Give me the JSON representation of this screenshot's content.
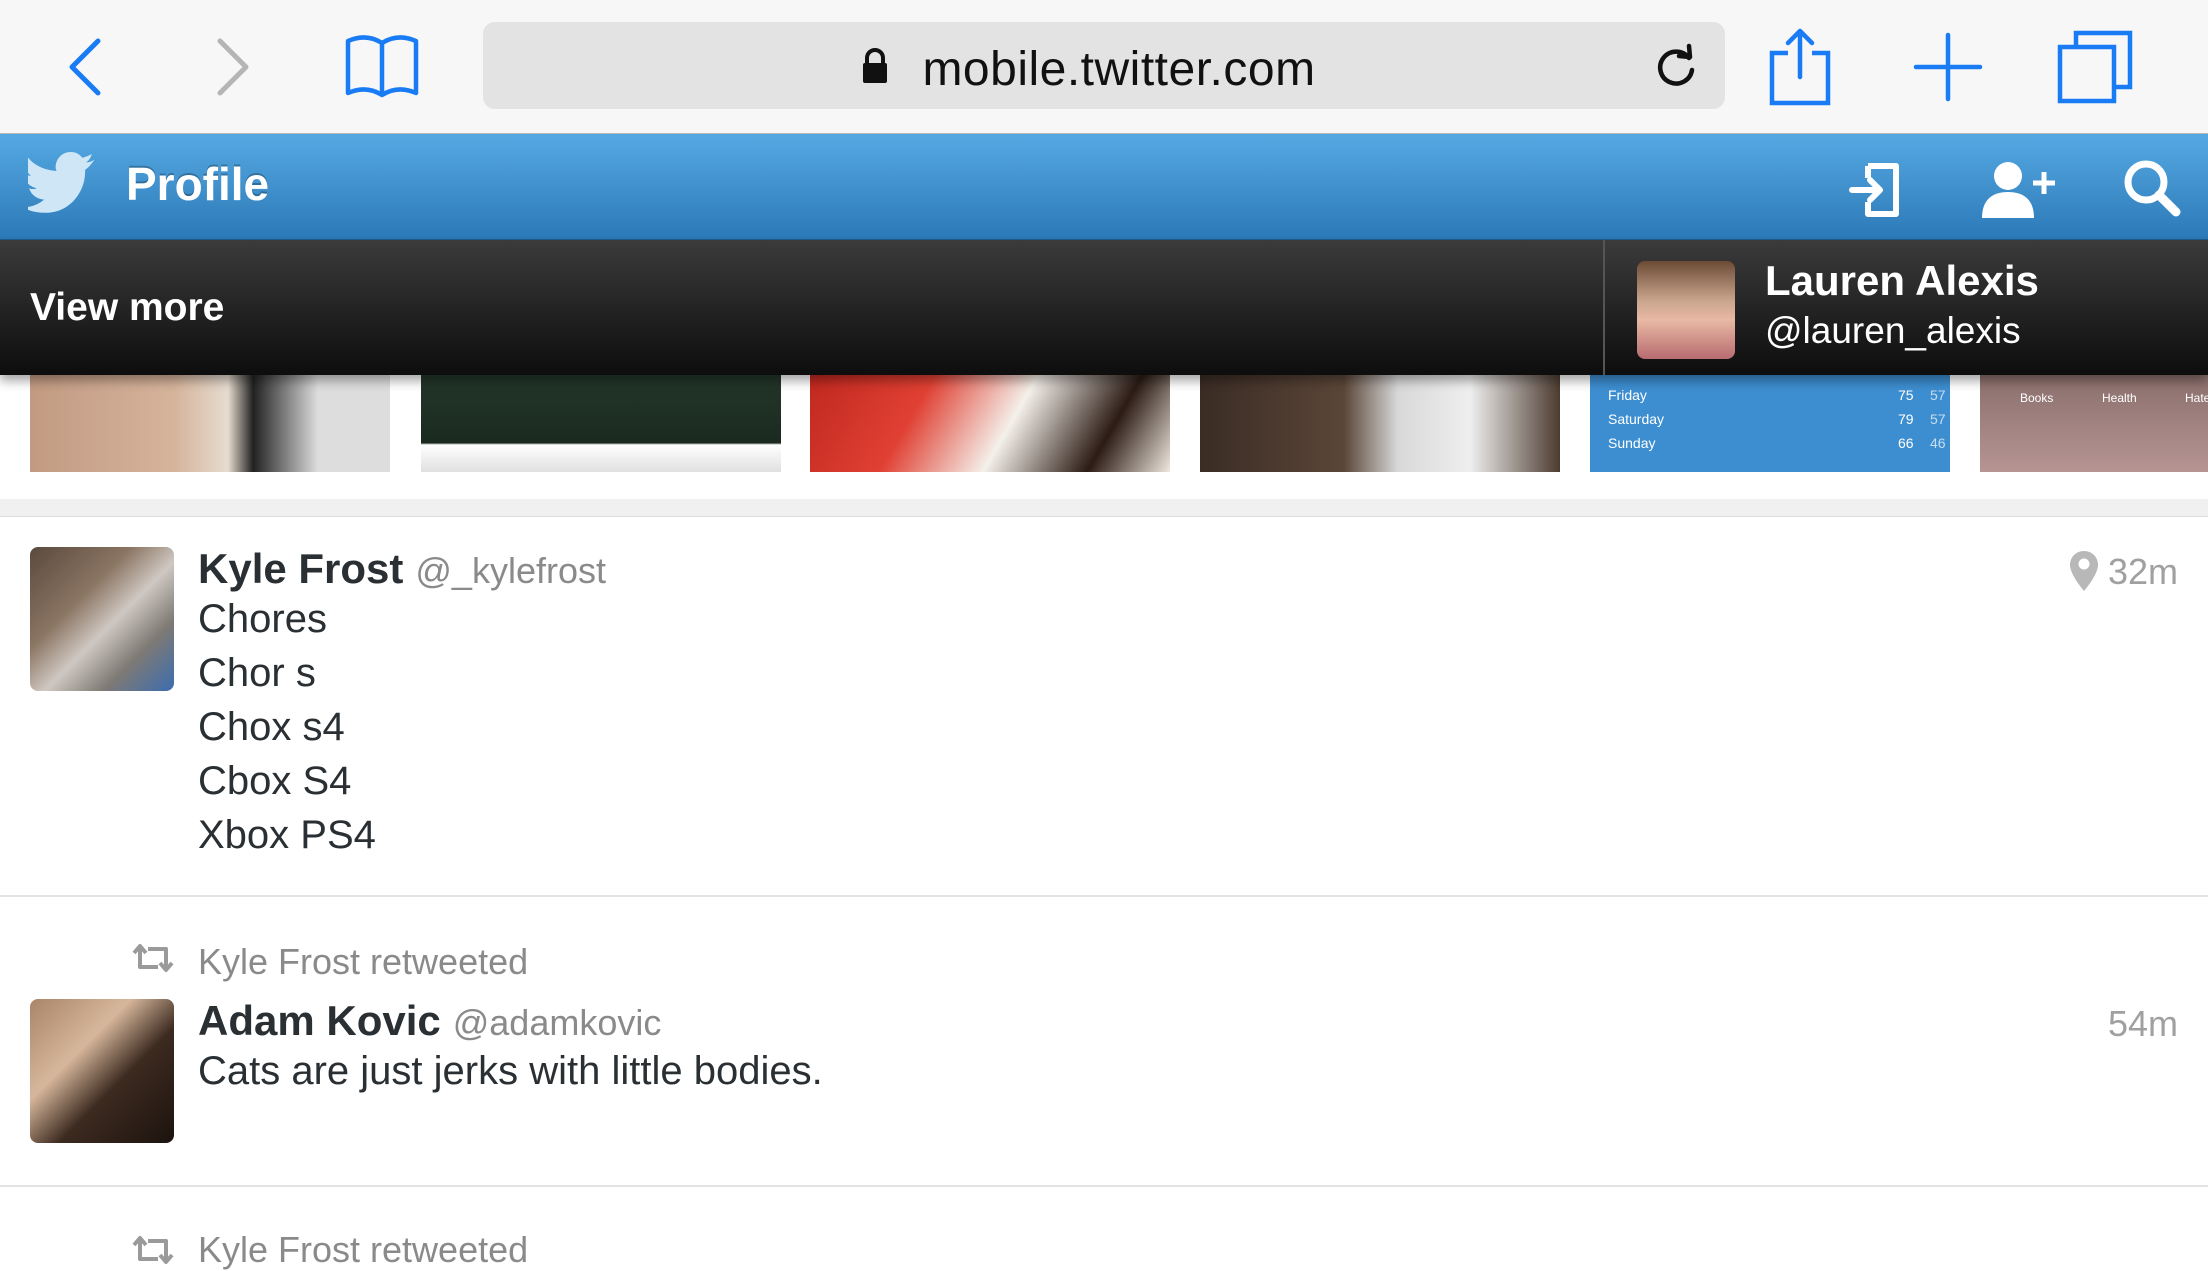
{
  "browser": {
    "url": "mobile.twitter.com",
    "icons": [
      "back-icon",
      "forward-icon",
      "bookmarks-icon",
      "lock-icon",
      "reload-icon",
      "share-icon",
      "new-tab-icon",
      "tabs-icon"
    ]
  },
  "header": {
    "title": "Profile",
    "icons": [
      "twitter-bird-icon",
      "sign-in-icon",
      "add-user-icon",
      "search-icon"
    ],
    "brand_color": "#3b94d9"
  },
  "follow_bar": {
    "view_more": "View more",
    "user": {
      "name": "Lauren Alexis",
      "handle": "@lauren_alexis"
    }
  },
  "media_strip": {
    "weather": [
      {
        "day": "Friday",
        "hi": "75",
        "lo": "57"
      },
      {
        "day": "Saturday",
        "hi": "79",
        "lo": "57"
      },
      {
        "day": "Sunday",
        "hi": "66",
        "lo": "46"
      }
    ],
    "app_labels": [
      "Books",
      "Health",
      "Hate"
    ]
  },
  "tweets": [
    {
      "name": "Kyle Frost",
      "handle": "@_kylefrost",
      "time": "32m",
      "lines": [
        "Chores",
        "Chor s",
        "Chox s4",
        "Cbox S4",
        "Xbox PS4"
      ]
    },
    {
      "retweeted_by": "Kyle Frost retweeted",
      "name": "Adam Kovic",
      "handle": "@adamkovic",
      "time": "54m",
      "lines": [
        "Cats are just jerks with little bodies."
      ]
    },
    {
      "retweeted_by": "Kyle Frost retweeted"
    }
  ]
}
